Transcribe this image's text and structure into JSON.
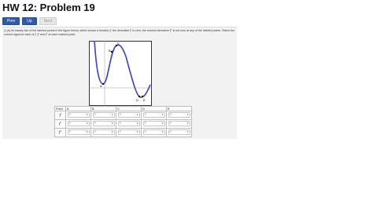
{
  "page": {
    "title": "HW 12: Problem 19"
  },
  "nav": {
    "prev": "Prev",
    "up": "Up",
    "next": "Next"
  },
  "problem": {
    "points_prefix": "(1 pt) At exactly two of the labeled points in the figure below, which shows a function",
    "f": "f",
    "derivative_text": ", the derivative",
    "f_prime": "f′",
    "is_zero": "is zero; the second derivative",
    "f_double_prime": "f″",
    "not_zero": "is not zero at any of the labeled points. Select the correct signs for each of",
    "and": "and",
    "each_point": "at each marked point."
  },
  "graph": {
    "point_labels": [
      "A",
      "B",
      "C",
      "D",
      "E"
    ],
    "colors": {
      "curve": "#3a3fcf",
      "axes": "#000000",
      "grid": "#9a9a9a"
    }
  },
  "table": {
    "header_label": "Point",
    "columns": [
      "A",
      "B",
      "C",
      "D",
      "E"
    ],
    "rows": [
      {
        "label": "f",
        "values": [
          "?",
          "?",
          "?",
          "?",
          "?"
        ]
      },
      {
        "label": "f′",
        "values": [
          "?",
          "?",
          "?",
          "?",
          "?"
        ]
      },
      {
        "label": "f″",
        "values": [
          "?",
          "?",
          "?",
          "?",
          "?"
        ]
      }
    ]
  }
}
